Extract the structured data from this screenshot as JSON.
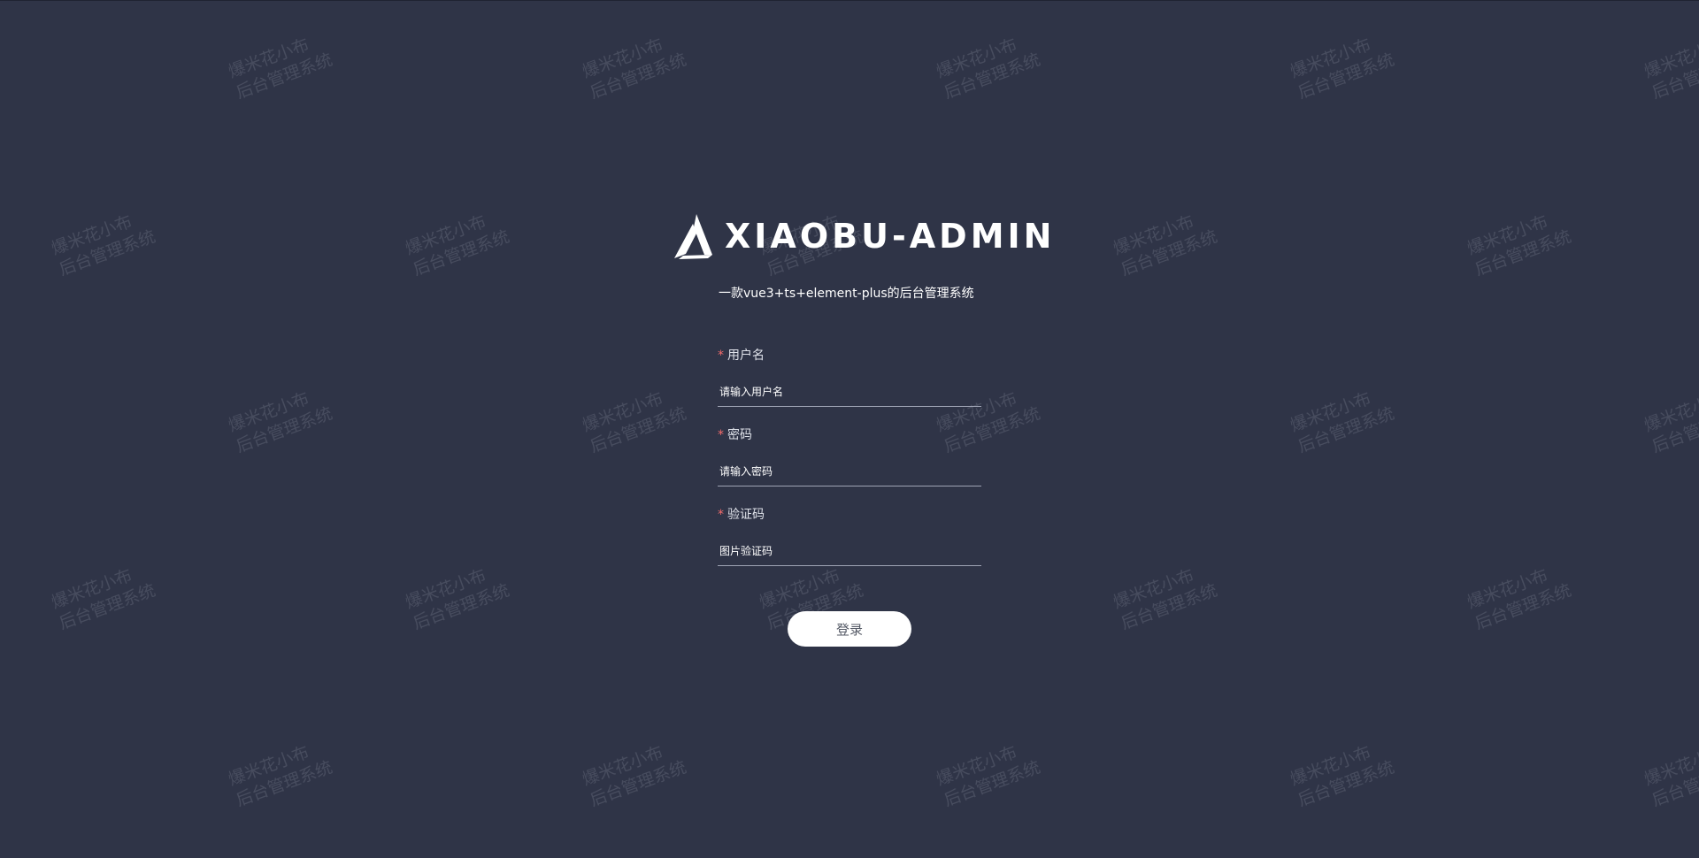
{
  "brand": {
    "logo_icon": "a-logo-icon",
    "title": "XIAOBU-ADMIN",
    "subtitle": "一款vue3+ts+element-plus的后台管理系统"
  },
  "form": {
    "username": {
      "required_mark": "*",
      "label": "用户名",
      "placeholder": "请输入用户名",
      "value": ""
    },
    "password": {
      "required_mark": "*",
      "label": "密码",
      "placeholder": "请输入密码",
      "value": ""
    },
    "captcha": {
      "required_mark": "*",
      "label": "验证码",
      "placeholder": "图片验证码",
      "value": ""
    },
    "submit_label": "登录"
  },
  "watermark": {
    "line1": "爆米花小布",
    "line2": "后台管理系统"
  },
  "colors": {
    "background": "#2f3447",
    "accent": "#ffffff",
    "required": "#f56c6c"
  }
}
